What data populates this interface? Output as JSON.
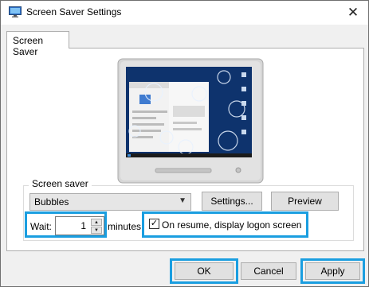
{
  "window": {
    "title": "Screen Saver Settings",
    "close_glyph": "✕"
  },
  "tabs": [
    {
      "label": "Screen Saver"
    }
  ],
  "screen_saver_group": {
    "label": "Screen saver",
    "selected": "Bubbles",
    "settings_label": "Settings...",
    "preview_label": "Preview",
    "wait_label": "Wait:",
    "wait_value": "1",
    "minutes_label": "minutes",
    "resume_label": "On resume, display logon screen",
    "resume_checked": true
  },
  "footer": {
    "ok_label": "OK",
    "cancel_label": "Cancel",
    "apply_label": "Apply"
  },
  "icons": {
    "app": "display-settings-icon",
    "close": "close-icon",
    "dropdown": "chevron-down-icon",
    "spin_up": "spin-up-icon",
    "spin_down": "spin-down-icon"
  },
  "colors": {
    "highlight": "#1a9ee0",
    "window_bg": "#f0f0f0",
    "panel_bg": "#ffffff",
    "button_bg": "#e1e1e1"
  }
}
